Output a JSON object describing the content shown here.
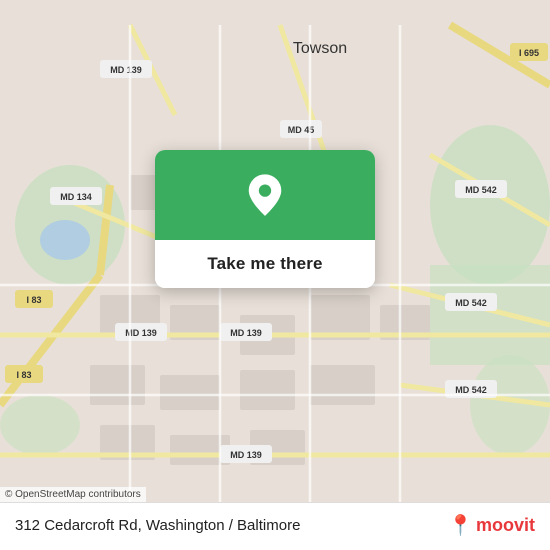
{
  "map": {
    "attribution": "© OpenStreetMap contributors",
    "bg_color": "#e8e0d8"
  },
  "cta": {
    "button_label": "Take me there",
    "pin_color": "#3aad5e"
  },
  "bottom_bar": {
    "address": "312 Cedarcroft Rd, Washington / Baltimore",
    "logo_text": "moovit"
  }
}
